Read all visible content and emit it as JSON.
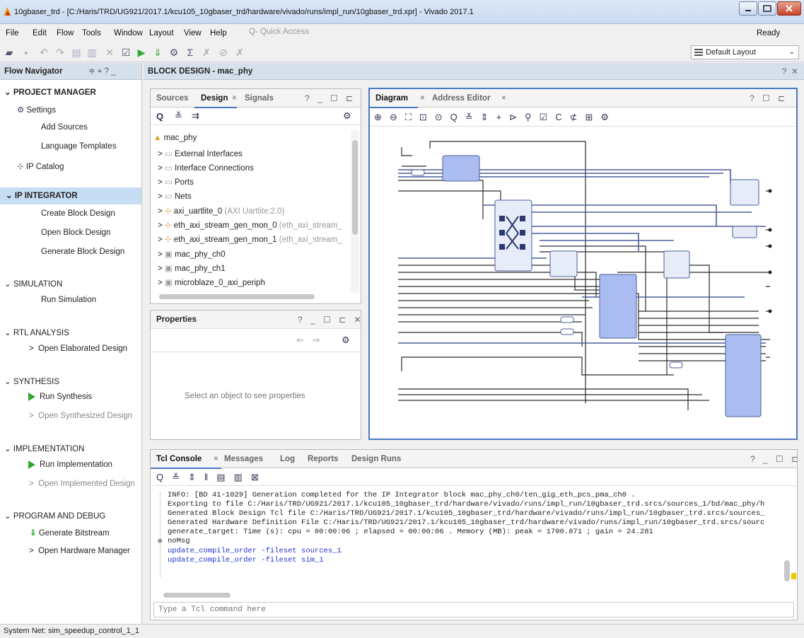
{
  "window": {
    "title": "10gbaser_trd - [C:/Haris/TRD/UG921/2017.1/kcu105_10gbaser_trd/hardware/vivado/runs/impl_run/10gbaser_trd.xpr] - Vivado 2017.1"
  },
  "menu": {
    "file": "File",
    "edit": "Edit",
    "flow": "Flow",
    "tools": "Tools",
    "window": "Window",
    "layout": "Layout",
    "view": "View",
    "help": "Help",
    "quick_access": "Q- Quick Access",
    "status": "Ready"
  },
  "toolbar": {
    "layout_select": "Default Layout"
  },
  "flow_navigator": {
    "title": "Flow Navigator",
    "project_manager": "PROJECT MANAGER",
    "settings": "Settings",
    "add_sources": "Add Sources",
    "language_templates": "Language Templates",
    "ip_catalog": "IP Catalog",
    "ip_integrator": "IP INTEGRATOR",
    "create_block_design": "Create Block Design",
    "open_block_design": "Open Block Design",
    "generate_block_design": "Generate Block Design",
    "simulation": "SIMULATION",
    "run_simulation": "Run Simulation",
    "rtl_analysis": "RTL ANALYSIS",
    "open_elaborated": "Open Elaborated Design",
    "synthesis": "SYNTHESIS",
    "run_synthesis": "Run Synthesis",
    "open_synthesized": "Open Synthesized Design",
    "implementation": "IMPLEMENTATION",
    "run_implementation": "Run Implementation",
    "open_implemented": "Open Implemented Design",
    "program_debug": "PROGRAM AND DEBUG",
    "generate_bitstream": "Generate Bitstream",
    "open_hw_manager": "Open Hardware Manager"
  },
  "block_design": {
    "title": "BLOCK DESIGN - mac_phy"
  },
  "sources_panel": {
    "tabs": [
      "Sources",
      "Design",
      "Signals"
    ],
    "tree": [
      {
        "label": "mac_phy",
        "extra": ""
      },
      {
        "label": "External Interfaces",
        "extra": ""
      },
      {
        "label": "Interface Connections",
        "extra": ""
      },
      {
        "label": "Ports",
        "extra": ""
      },
      {
        "label": "Nets",
        "extra": ""
      },
      {
        "label": "axi_uartlite_0",
        "extra": "(AXI Uartlite:2.0)"
      },
      {
        "label": "eth_axi_stream_gen_mon_0",
        "extra": "(eth_axi_stream_"
      },
      {
        "label": "eth_axi_stream_gen_mon_1",
        "extra": "(eth_axi_stream_"
      },
      {
        "label": "mac_phy_ch0",
        "extra": ""
      },
      {
        "label": "mac_phy_ch1",
        "extra": ""
      },
      {
        "label": "microblaze_0_axi_periph",
        "extra": ""
      }
    ]
  },
  "properties_panel": {
    "title": "Properties",
    "empty_text": "Select an object to see properties"
  },
  "diagram_panel": {
    "tabs": [
      "Diagram",
      "Address Editor"
    ]
  },
  "console": {
    "tabs": [
      "Tcl Console",
      "Messages",
      "Log",
      "Reports",
      "Design Runs"
    ],
    "lines": [
      "INFO: [BD 41-1029] Generation completed for the IP Integrator block mac_phy_ch0/ten_gig_eth_pcs_pma_ch0 .",
      "Exporting to file C:/Haris/TRD/UG921/2017.1/kcu105_10gbaser_trd/hardware/vivado/runs/impl_run/10gbaser_trd.srcs/sources_1/bd/mac_phy/h",
      "Generated Block Design Tcl file C:/Haris/TRD/UG921/2017.1/kcu105_10gbaser_trd/hardware/vivado/runs/impl_run/10gbaser_trd.srcs/sources_",
      "Generated Hardware Definition File C:/Haris/TRD/UG921/2017.1/kcu105_10gbaser_trd/hardware/vivado/runs/impl_run/10gbaser_trd.srcs/sourc",
      "generate_target: Time (s): cpu = 00:00:06 ; elapsed = 00:00:06 . Memory (MB): peak = 1700.871 ; gain = 24.281"
    ],
    "nomsg": "noMsg",
    "cmd1": "update_compile_order -fileset sources_1",
    "cmd2": "update_compile_order -fileset sim_1",
    "input_placeholder": "Type a Tcl command here"
  },
  "status_bar": {
    "text": "System Net: sim_speedup_control_1_1"
  },
  "colors": {
    "accent": "#4a78c0",
    "selected": "#c7ddf4",
    "block_fill": "#aabcf0",
    "green": "#2eaa2e"
  }
}
